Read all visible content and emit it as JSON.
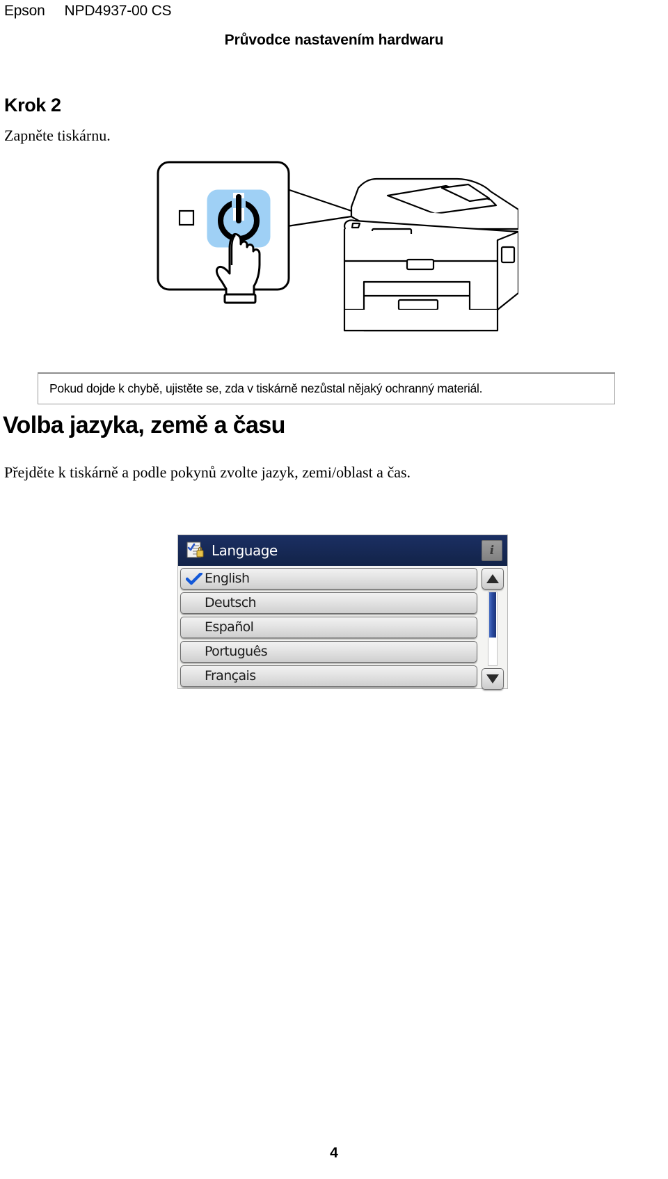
{
  "header": {
    "brand": "Epson",
    "document_number": "NPD4937-00 CS",
    "title": "Průvodce nastavením hardwaru"
  },
  "step": {
    "heading": "Krok 2",
    "instruction": "Zapněte tiskárnu."
  },
  "illustration": {
    "name": "printer-power-button-illustration",
    "callout_icon": "power-icon",
    "hand_icon": "pointing-hand-icon",
    "button_color": "#9fd0f5"
  },
  "note": {
    "text": "Pokud dojde k chybě, ujistěte se, zda v tiskárně nezůstal nějaký ochranný materiál."
  },
  "section": {
    "heading": "Volba jazyka, země a času",
    "text": "Přejděte k tiskárně a podle pokynů zvolte jazyk, zemi/oblast a čas."
  },
  "lcd": {
    "titlebar": {
      "icon": "settings-list-lock-icon",
      "label": "Language",
      "info_button_label": "i"
    },
    "items": [
      {
        "label": "English",
        "checked": true
      },
      {
        "label": "Deutsch",
        "checked": false
      },
      {
        "label": "Español",
        "checked": false
      },
      {
        "label": "Português",
        "checked": false
      },
      {
        "label": "Français",
        "checked": false
      }
    ],
    "scroll": {
      "up_icon": "triangle-up-icon",
      "down_icon": "triangle-down-icon"
    },
    "colors": {
      "titlebar": "#15264e",
      "check": "#1358d8"
    }
  },
  "footer": {
    "page_number": "4"
  }
}
